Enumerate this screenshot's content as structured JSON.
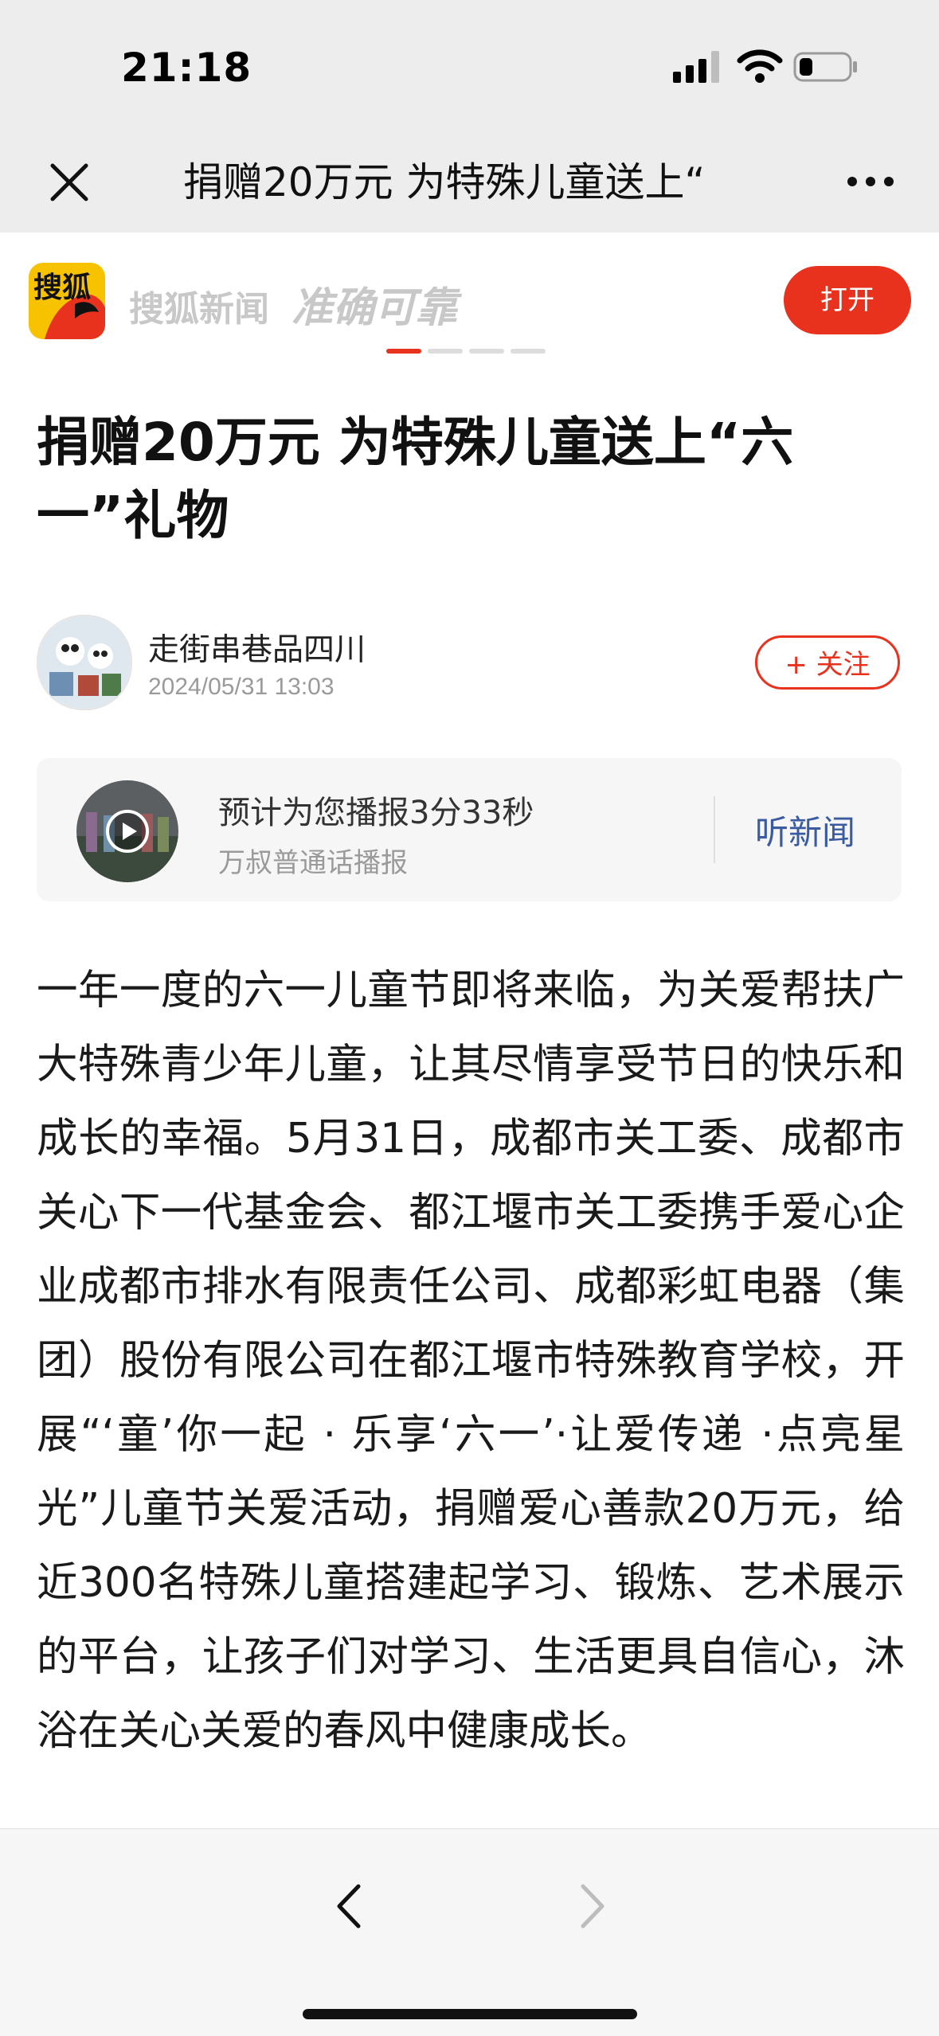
{
  "status_bar": {
    "time": "21:18",
    "icons": [
      "cellular-signal-icon",
      "wifi-icon",
      "battery-icon"
    ]
  },
  "nav": {
    "title": "捐赠20万元 为特殊儿童送上“",
    "close_icon": "close-icon",
    "more_icon": "more-dots-icon"
  },
  "banner": {
    "logo_text": "搜狐",
    "brand": "搜狐新闻",
    "motto": "准确可靠",
    "open_label": "打开",
    "accent": "#e8321d"
  },
  "article": {
    "headline": "捐赠20万元 为特殊儿童送上“六一”礼物",
    "author_name": "走街串巷品四川",
    "date": "2024/05/31 13:03",
    "follow_label": "+ 关注",
    "player": {
      "line1": "预计为您播报3分33秒",
      "line2": "万叔普通话播报",
      "listen_label": "听新闻",
      "icon": "play-icon"
    },
    "body": "一年一度的六一儿童节即将来临，为关爱帮扶广大特殊青少年儿童，让其尽情享受节日的快乐和成长的幸福。5月31日，成都市关工委、成都市关心下一代基金会、都江堰市关工委携手爱心企业成都市排水有限责任公司、成都彩虹电器（集团）股份有限公司在都江堰市特殊教育学校，开展“‘童’你一起 · 乐享‘六一’·让爱传递 ·点亮星光”儿童节关爱活动，捐赠爱心善款20万元，给近300名特殊儿童搭建起学习、锻炼、艺术展示的平台，让孩子们对学习、生活更具自信心，沐浴在关心关爱的春风中健康成长。"
  },
  "toolbar": {
    "back_icon": "chevron-left-icon",
    "forward_icon": "chevron-right-icon"
  }
}
